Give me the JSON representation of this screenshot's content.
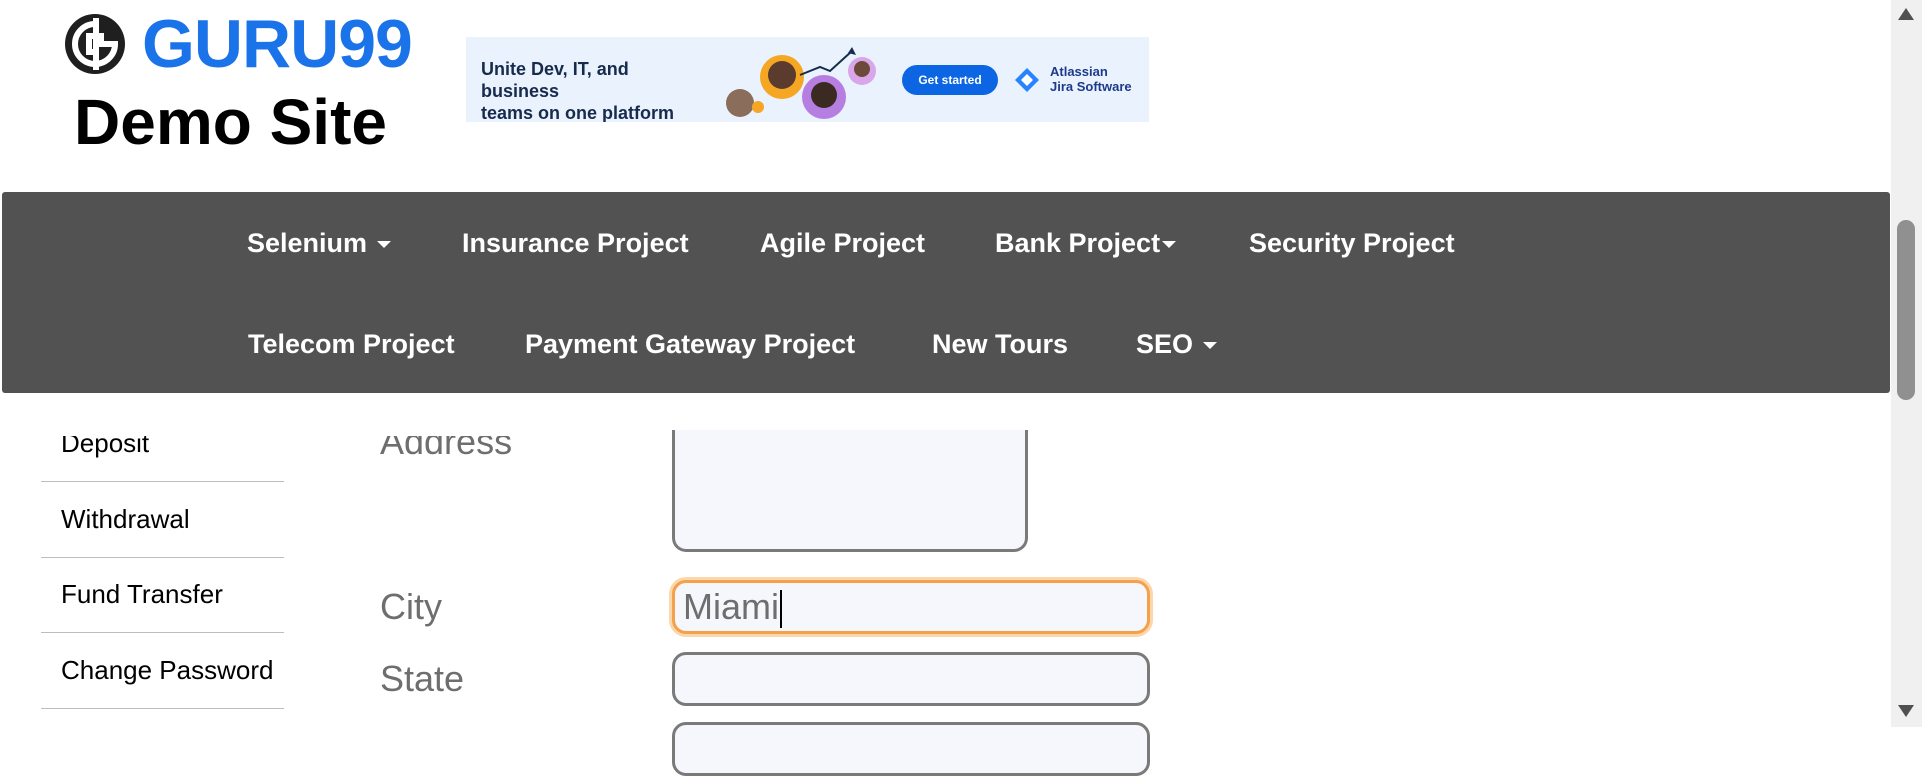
{
  "header": {
    "logo_text": "GURU99",
    "site_title": "Demo Site"
  },
  "ad": {
    "headline_line1": "Unite Dev, IT, and business",
    "headline_line2": "teams on one platform",
    "cta": "Get started",
    "brand_line1": "Atlassian",
    "brand_line2": "Jira Software"
  },
  "nav": {
    "row1": [
      {
        "label": "Selenium",
        "dropdown": true
      },
      {
        "label": "Insurance Project",
        "dropdown": false
      },
      {
        "label": "Agile Project",
        "dropdown": false
      },
      {
        "label": "Bank Project",
        "dropdown": true
      },
      {
        "label": "Security Project",
        "dropdown": false
      }
    ],
    "row2": [
      {
        "label": "Telecom Project",
        "dropdown": false
      },
      {
        "label": "Payment Gateway Project",
        "dropdown": false
      },
      {
        "label": "New Tours",
        "dropdown": false
      },
      {
        "label": "SEO",
        "dropdown": true
      }
    ]
  },
  "sidebar": {
    "items": [
      {
        "label": "Deposit"
      },
      {
        "label": "Withdrawal"
      },
      {
        "label": "Fund Transfer"
      },
      {
        "label": "Change Password"
      }
    ]
  },
  "form": {
    "address_label": "Address",
    "address_value": "",
    "city_label": "City",
    "city_value": "Miami",
    "state_label": "State",
    "state_value": ""
  },
  "colors": {
    "brand_blue": "#1a73e8",
    "nav_bg": "#525252",
    "focus_outline": "#f5a04a"
  }
}
